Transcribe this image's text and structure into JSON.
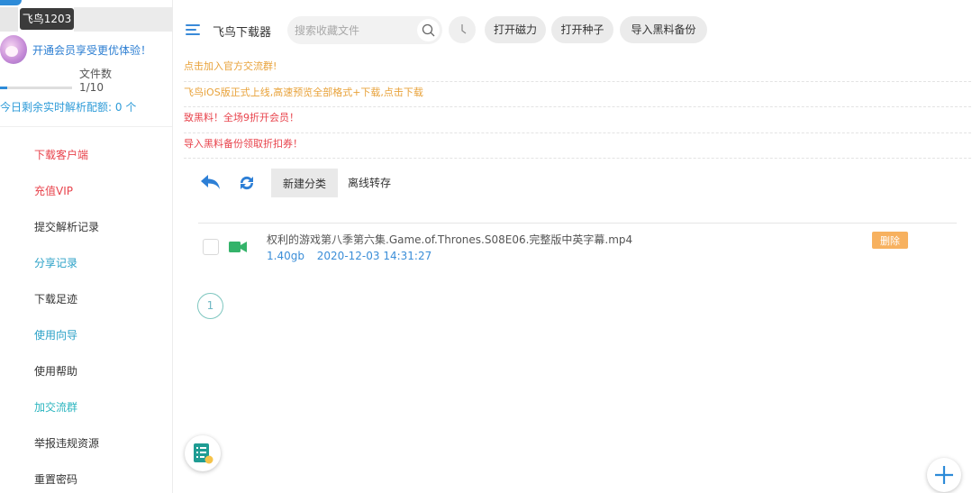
{
  "sidebar": {
    "tooltip": "飞鸟1203",
    "vip_link": "开通会员享受更优体验！",
    "files_label": "文件数",
    "files_count": "1/10",
    "files_progress": 0.1,
    "quota_label": "今日剩余实时解析配额:",
    "quota_value": "0",
    "quota_unit": "个",
    "items": [
      {
        "label": "下载客户端",
        "color": "#e8434c"
      },
      {
        "label": "充值VIP",
        "color": "#e8434c"
      },
      {
        "label": "提交解析记录",
        "color": "#333333"
      },
      {
        "label": "分享记录",
        "color": "#2ba1c7"
      },
      {
        "label": "下载足迹",
        "color": "#333333"
      },
      {
        "label": "使用向导",
        "color": "#2ba1c7"
      },
      {
        "label": "使用帮助",
        "color": "#333333"
      },
      {
        "label": "加交流群",
        "color": "#2bb5bf"
      },
      {
        "label": "举报违规资源",
        "color": "#333333"
      },
      {
        "label": "重置密码",
        "color": "#333333"
      }
    ]
  },
  "topbar": {
    "title": "飞鸟下载器",
    "search_placeholder": "搜索收藏文件",
    "buttons": [
      "打开磁力",
      "打开种子",
      "导入黑料备份"
    ]
  },
  "notices": [
    {
      "text": "点击加入官方交流群!",
      "color": "#e8a23a"
    },
    {
      "text": "飞鸟iOS版正式上线,高速预览全部格式+下载,点击下载",
      "color": "#e8a23a"
    },
    {
      "text": "致黑料！全场9折开会员！",
      "color": "#e8434c"
    },
    {
      "text": "导入黑料备份领取折扣券！",
      "color": "#e8434c"
    }
  ],
  "toolbar": {
    "new_category": "新建分类",
    "offline_transfer": "离线转存"
  },
  "files": [
    {
      "name": "权利的游戏第八季第六集.Game.of.Thrones.S08E06.完整版中英字幕.mp4",
      "size": "1.40gb",
      "date": "2020-12-03 14:31:27",
      "delete_label": "删除"
    }
  ],
  "pagination": {
    "current": "1"
  },
  "colors": {
    "accent": "#2d8bd8",
    "delete": "#f7b15f",
    "video": "#34b36a"
  }
}
